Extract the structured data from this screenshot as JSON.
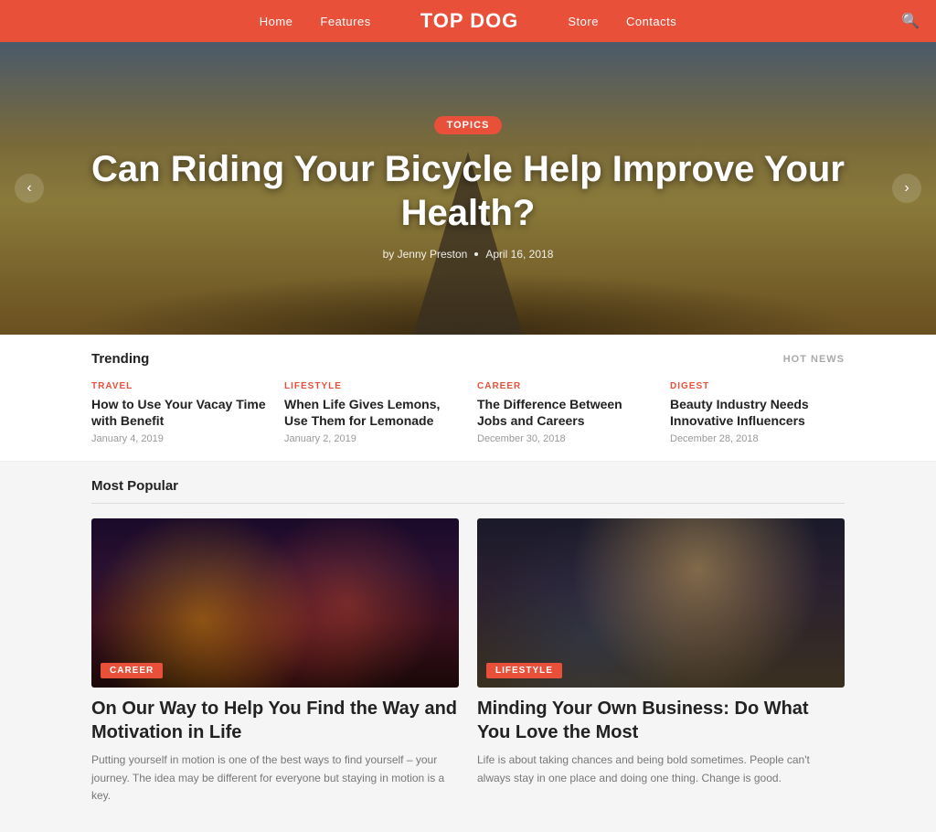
{
  "nav": {
    "links": [
      "Home",
      "Features",
      "Store",
      "Contacts"
    ],
    "logo": "TOP DOG"
  },
  "hero": {
    "badge": "TOPICS",
    "title": "Can Riding Your Bicycle Help Improve Your Health?",
    "author": "by Jenny Preston",
    "date": "April 16, 2018"
  },
  "trending": {
    "label": "Trending",
    "hot_news": "HOT NEWS",
    "items": [
      {
        "category": "TRAVEL",
        "title": "How to Use Your Vacay Time with Benefit",
        "date": "January 4, 2019"
      },
      {
        "category": "LIFESTYLE",
        "title": "When Life Gives Lemons, Use Them for Lemonade",
        "date": "January 2, 2019"
      },
      {
        "category": "CAREER",
        "title": "The Difference Between Jobs and Careers",
        "date": "December 30, 2018"
      },
      {
        "category": "DIGEST",
        "title": "Beauty Industry Needs Innovative Influencers",
        "date": "December 28, 2018"
      }
    ]
  },
  "popular": {
    "label": "Most Popular",
    "cards": [
      {
        "category": "CAREER",
        "title": "On Our Way to Help You Find the Way and Motivation in Life",
        "excerpt": "Putting yourself in motion is one of the best ways to find yourself – your journey. The idea may be different for everyone but staying in motion is a key.",
        "scene": "city"
      },
      {
        "category": "LIFESTYLE",
        "title": "Minding Your Own Business: Do What You Love the Most",
        "excerpt": "Life is about taking chances and being bold sometimes. People can't always stay in one place and doing one thing. Change is good.",
        "scene": "office"
      }
    ]
  }
}
